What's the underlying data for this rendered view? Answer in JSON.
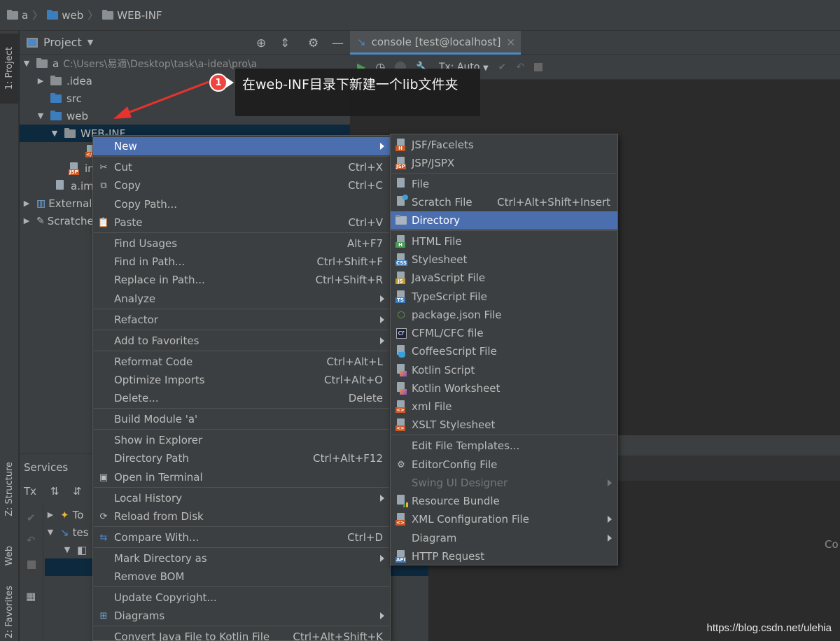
{
  "breadcrumb": {
    "items": [
      "a",
      "web",
      "WEB-INF"
    ]
  },
  "left_stripe": {
    "project_tab": "1: Project",
    "structure_tab": "Z: Structure",
    "web_tab": "Web",
    "favorites_tab": "2: Favorites"
  },
  "project_panel": {
    "title": "Project",
    "tree": [
      {
        "label": "a",
        "path": "C:\\Users\\易適\\Desktop\\task\\a-idea\\pro\\a"
      },
      {
        "label": ".idea"
      },
      {
        "label": "src"
      },
      {
        "label": "web"
      },
      {
        "label": "WEB-INF"
      },
      {
        "label": ""
      },
      {
        "label": "in"
      },
      {
        "label": "a.iml"
      },
      {
        "label": "External"
      },
      {
        "label": "Scratche"
      }
    ]
  },
  "editor": {
    "tab_label": "console [test@localhost]",
    "tx_label": "Tx: Auto",
    "right_text": "Co"
  },
  "services": {
    "title": "Services",
    "tx": "Tx",
    "rows": [
      "To",
      "tes",
      ""
    ]
  },
  "callout": {
    "badge": "1",
    "text": "在web-INF目录下新建一个lib文件夹"
  },
  "context_menu": {
    "items": [
      {
        "label": "New",
        "shortcut": ""
      },
      {
        "label": "Cut",
        "shortcut": "Ctrl+X"
      },
      {
        "label": "Copy",
        "shortcut": "Ctrl+C"
      },
      {
        "label": "Copy Path...",
        "shortcut": ""
      },
      {
        "label": "Paste",
        "shortcut": "Ctrl+V"
      },
      {
        "label": "Find Usages",
        "shortcut": "Alt+F7"
      },
      {
        "label": "Find in Path...",
        "shortcut": "Ctrl+Shift+F"
      },
      {
        "label": "Replace in Path...",
        "shortcut": "Ctrl+Shift+R"
      },
      {
        "label": "Analyze",
        "shortcut": ""
      },
      {
        "label": "Refactor",
        "shortcut": ""
      },
      {
        "label": "Add to Favorites",
        "shortcut": ""
      },
      {
        "label": "Reformat Code",
        "shortcut": "Ctrl+Alt+L"
      },
      {
        "label": "Optimize Imports",
        "shortcut": "Ctrl+Alt+O"
      },
      {
        "label": "Delete...",
        "shortcut": "Delete"
      },
      {
        "label": "Build Module 'a'",
        "shortcut": ""
      },
      {
        "label": "Show in Explorer",
        "shortcut": ""
      },
      {
        "label": "Directory Path",
        "shortcut": "Ctrl+Alt+F12"
      },
      {
        "label": "Open in Terminal",
        "shortcut": ""
      },
      {
        "label": "Local History",
        "shortcut": ""
      },
      {
        "label": "Reload from Disk",
        "shortcut": ""
      },
      {
        "label": "Compare With...",
        "shortcut": "Ctrl+D"
      },
      {
        "label": "Mark Directory as",
        "shortcut": ""
      },
      {
        "label": "Remove BOM",
        "shortcut": ""
      },
      {
        "label": "Update Copyright...",
        "shortcut": ""
      },
      {
        "label": "Diagrams",
        "shortcut": ""
      },
      {
        "label": "Convert Java File to Kotlin File",
        "shortcut": "Ctrl+Alt+Shift+K"
      }
    ]
  },
  "new_submenu": {
    "items": [
      {
        "label": "JSF/Facelets",
        "shortcut": ""
      },
      {
        "label": "JSP/JSPX",
        "shortcut": ""
      },
      {
        "label": "File",
        "shortcut": ""
      },
      {
        "label": "Scratch File",
        "shortcut": "Ctrl+Alt+Shift+Insert"
      },
      {
        "label": "Directory",
        "shortcut": ""
      },
      {
        "label": "HTML File",
        "shortcut": ""
      },
      {
        "label": "Stylesheet",
        "shortcut": ""
      },
      {
        "label": "JavaScript File",
        "shortcut": ""
      },
      {
        "label": "TypeScript File",
        "shortcut": ""
      },
      {
        "label": "package.json File",
        "shortcut": ""
      },
      {
        "label": "CFML/CFC file",
        "shortcut": ""
      },
      {
        "label": "CoffeeScript File",
        "shortcut": ""
      },
      {
        "label": "Kotlin Script",
        "shortcut": ""
      },
      {
        "label": "Kotlin Worksheet",
        "shortcut": ""
      },
      {
        "label": "xml  File",
        "shortcut": ""
      },
      {
        "label": "XSLT Stylesheet",
        "shortcut": ""
      },
      {
        "label": "Edit File Templates...",
        "shortcut": ""
      },
      {
        "label": "EditorConfig File",
        "shortcut": ""
      },
      {
        "label": "Swing UI Designer",
        "shortcut": ""
      },
      {
        "label": "Resource Bundle",
        "shortcut": ""
      },
      {
        "label": "XML Configuration File",
        "shortcut": ""
      },
      {
        "label": "Diagram",
        "shortcut": ""
      },
      {
        "label": "HTTP Request",
        "shortcut": ""
      }
    ]
  },
  "icon_tags": {
    "h": "H",
    "jsp": "JSP",
    "css": "CSS",
    "js": "JS",
    "ts": "TS",
    "cf": "Cf",
    "api": "API"
  },
  "watermark": "https://blog.csdn.net/ulehia",
  "colors": {
    "highlight": "#4b6eaf",
    "panel": "#3c3f41",
    "editor_bg": "#2b2b2b",
    "badge": "#f0443f",
    "arrow": "#e8322d"
  }
}
